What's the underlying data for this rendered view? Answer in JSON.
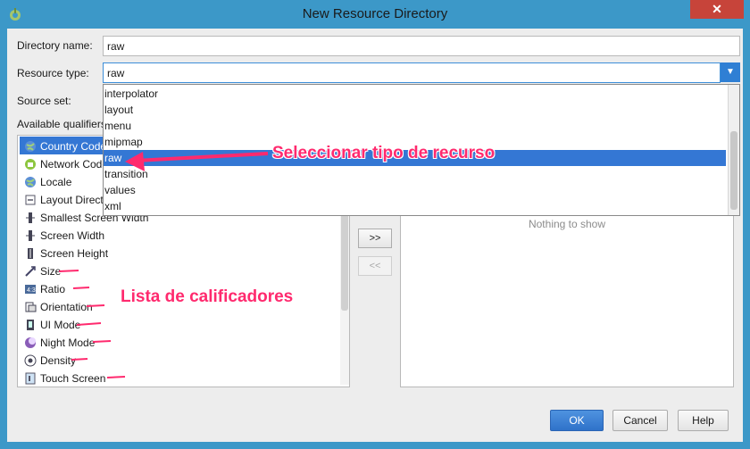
{
  "window": {
    "title": "New Resource Directory",
    "close_glyph": "✕"
  },
  "form": {
    "directory_name_label": "Directory name:",
    "directory_name_value": "raw",
    "resource_type_label": "Resource type:",
    "resource_type_value": "raw",
    "source_set_label": "Source set:",
    "available_qualifiers_label": "Available qualifiers:"
  },
  "dropdown": {
    "options": [
      "interpolator",
      "layout",
      "menu",
      "mipmap",
      "raw",
      "transition",
      "values",
      "xml"
    ],
    "selected_index": 4
  },
  "qualifiers": {
    "items": [
      {
        "label": "Country Code",
        "icon": "globe-icon"
      },
      {
        "label": "Network Code",
        "icon": "network-icon"
      },
      {
        "label": "Locale",
        "icon": "globe-icon"
      },
      {
        "label": "Layout Direction",
        "icon": "direction-icon"
      },
      {
        "label": "Smallest Screen Width",
        "icon": "width-icon"
      },
      {
        "label": "Screen Width",
        "icon": "width-icon"
      },
      {
        "label": "Screen Height",
        "icon": "height-icon"
      },
      {
        "label": "Size",
        "icon": "size-icon"
      },
      {
        "label": "Ratio",
        "icon": "ratio-icon"
      },
      {
        "label": "Orientation",
        "icon": "orientation-icon"
      },
      {
        "label": "UI Mode",
        "icon": "ui-mode-icon"
      },
      {
        "label": "Night Mode",
        "icon": "night-mode-icon"
      },
      {
        "label": "Density",
        "icon": "density-icon"
      },
      {
        "label": "Touch Screen",
        "icon": "touch-icon"
      }
    ],
    "selected_index": 0
  },
  "chosen_qualifiers": {
    "empty_text": "Nothing to show"
  },
  "move_buttons": {
    "add": ">>",
    "remove": "<<"
  },
  "buttons": {
    "ok": "OK",
    "cancel": "Cancel",
    "help": "Help"
  },
  "annotations": {
    "resource_type": "Seleccionar tipo de recurso",
    "qualifiers": "Lista de calificadores",
    "color": "#ff2a6e"
  }
}
